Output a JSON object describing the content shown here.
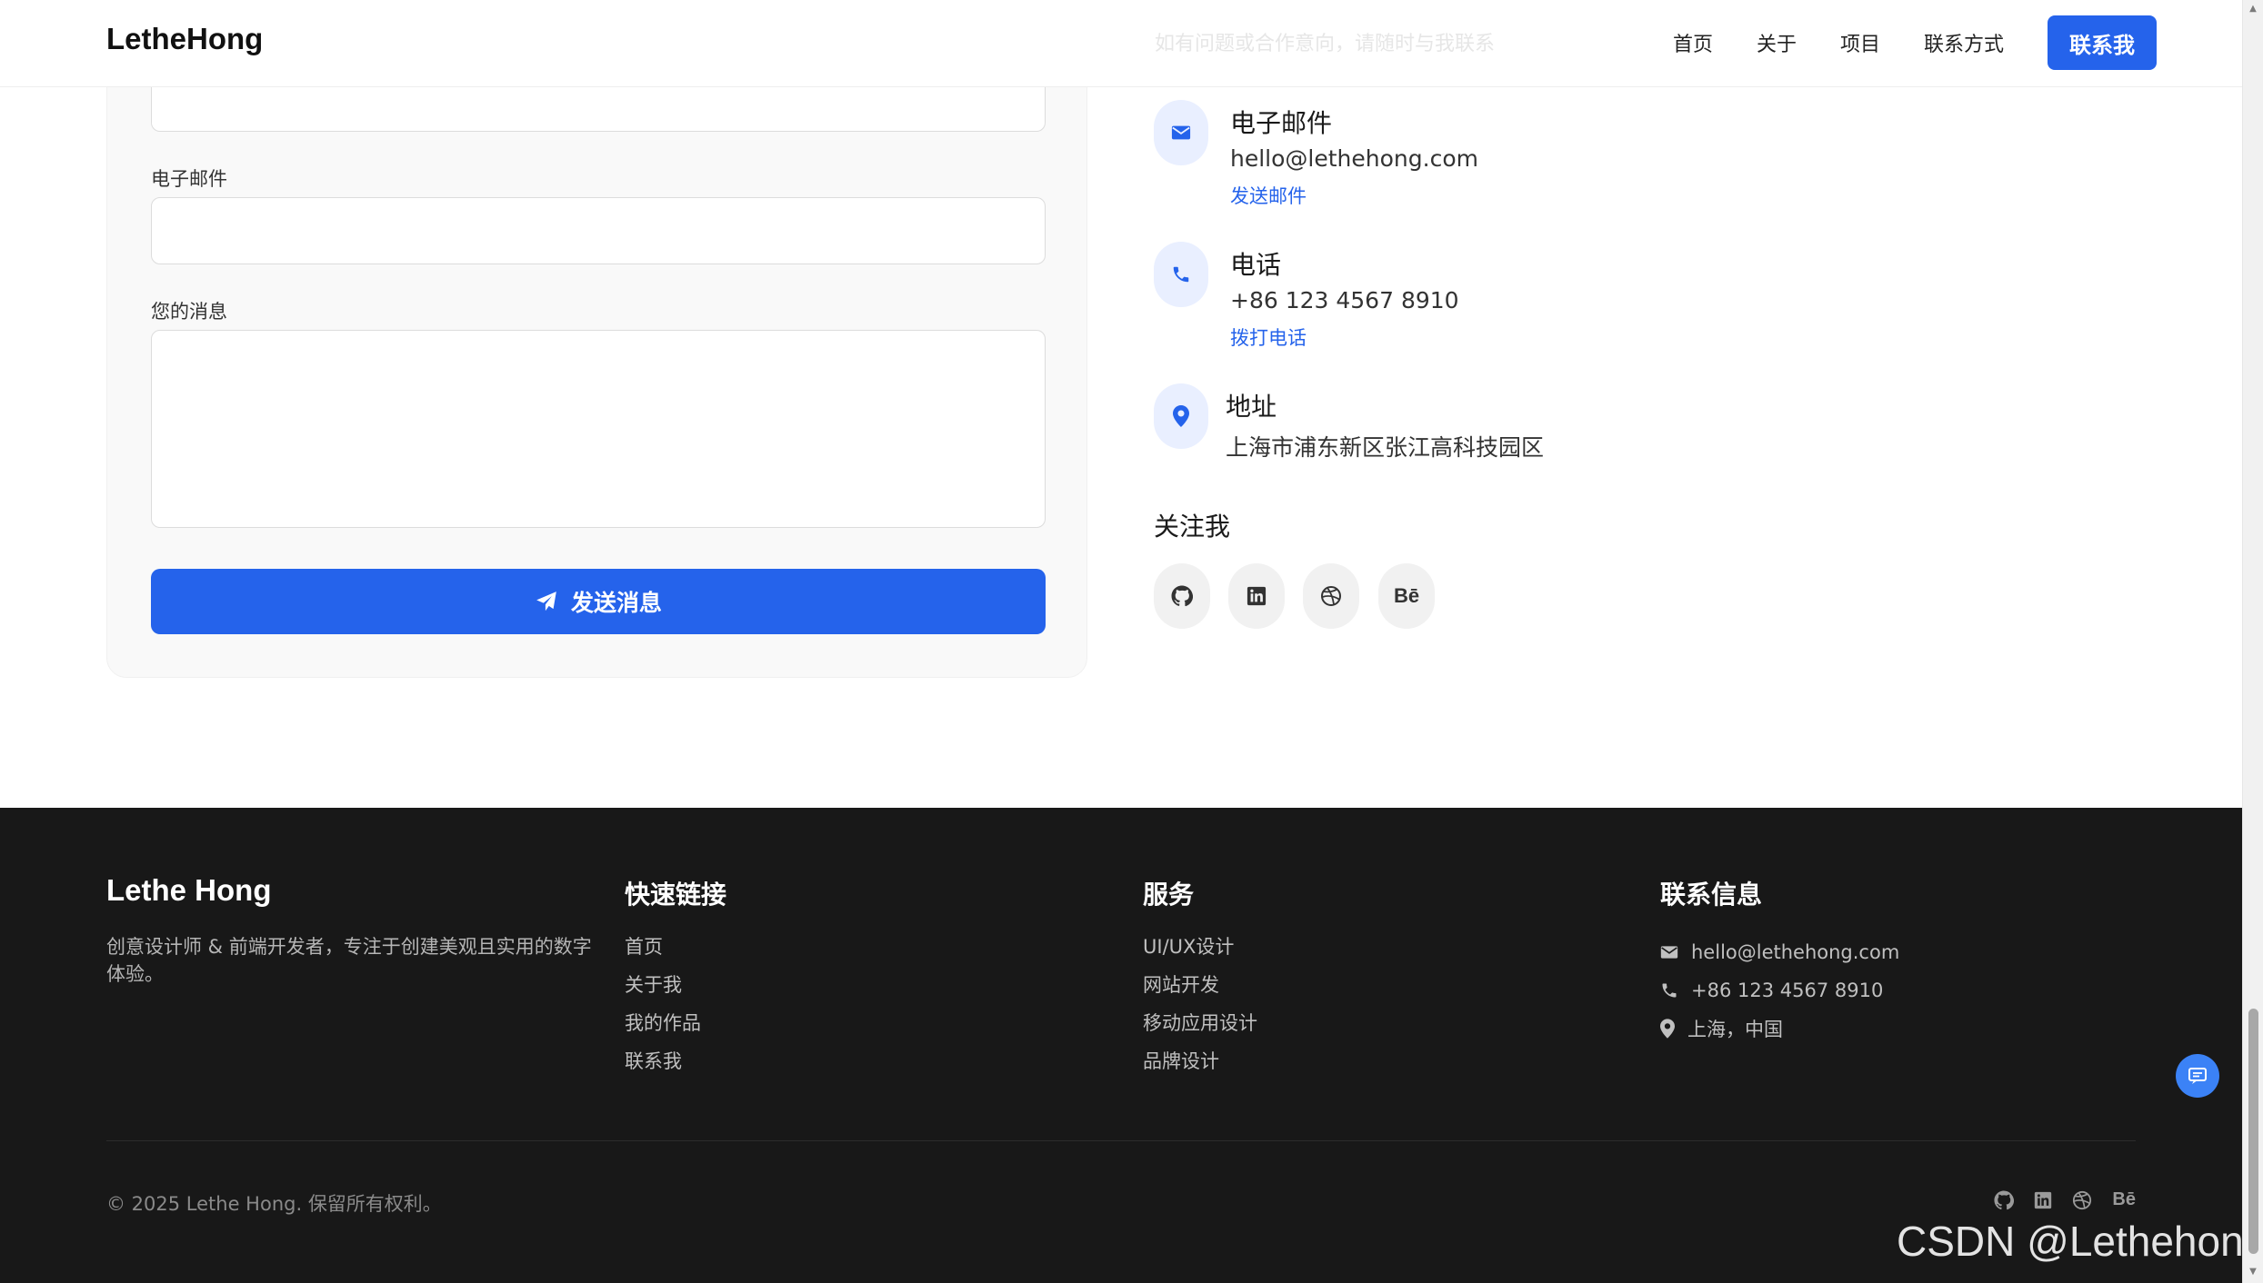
{
  "header": {
    "logo": "LetheHong",
    "nav": [
      "首页",
      "关于",
      "项目",
      "联系方式"
    ],
    "cta": "联系我",
    "faded_text": "如有问题或合作意向，请随时与我联系"
  },
  "form": {
    "email_label": "电子邮件",
    "message_label": "您的消息",
    "send_button": "发送消息"
  },
  "contact": {
    "email": {
      "title": "电子邮件",
      "value": "hello@lethehong.com",
      "link": "发送邮件"
    },
    "phone": {
      "title": "电话",
      "value": "+86 123 4567 8910",
      "link": "拨打电话"
    },
    "address": {
      "title": "地址",
      "value": "上海市浦东新区张江高科技园区"
    },
    "follow_title": "关注我",
    "social": [
      "github-icon",
      "linkedin-icon",
      "dribbble-icon",
      "behance-icon"
    ],
    "behance_label": "Bē"
  },
  "footer": {
    "brand": "Lethe Hong",
    "description": "创意设计师 & 前端开发者，专注于创建美观且实用的数字体验。",
    "quick_links_title": "快速链接",
    "quick_links": [
      "首页",
      "关于我",
      "我的作品",
      "联系我"
    ],
    "services_title": "服务",
    "services": [
      "UI/UX设计",
      "网站开发",
      "移动应用设计",
      "品牌设计"
    ],
    "contact_title": "联系信息",
    "contact_email": "hello@lethehong.com",
    "contact_phone": "+86 123 4567 8910",
    "contact_location": "上海，中国",
    "copyright": "© 2025 Lethe Hong. 保留所有权利。",
    "watermark": "CSDN @Lethehong"
  },
  "colors": {
    "accent": "#2563eb",
    "footer_bg": "#181818",
    "icon_bg": "#e9efff"
  }
}
